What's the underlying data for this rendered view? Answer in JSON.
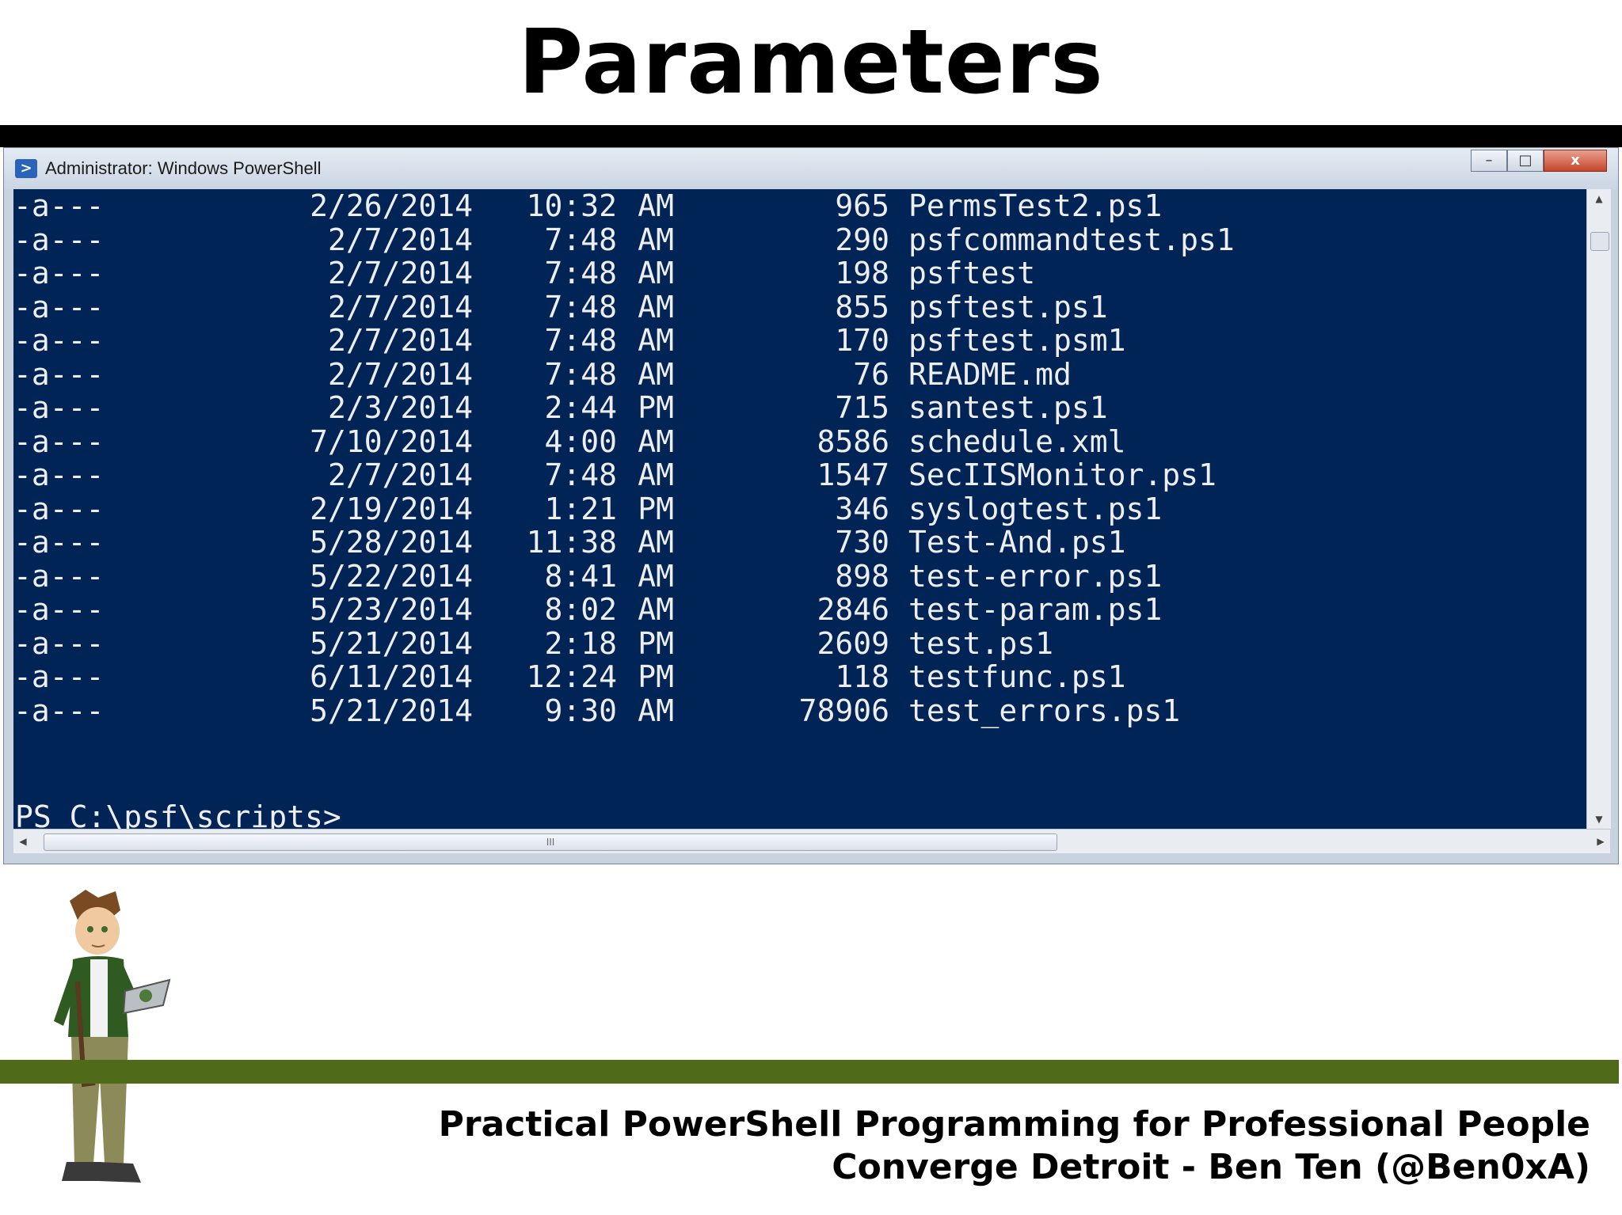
{
  "slide": {
    "title": "Parameters",
    "footer_line1": "Practical PowerShell Programming for Professional People",
    "footer_line2": "Converge Detroit - Ben Ten (@Ben0xA)"
  },
  "window": {
    "title": "Administrator: Windows PowerShell",
    "minimize_glyph": "–",
    "maximize_glyph": "□",
    "close_glyph": "x",
    "app_icon_glyph": ">"
  },
  "console": {
    "rows": [
      {
        "mode": "-a---",
        "date": "2/26/2014",
        "time": "10:32",
        "ampm": "AM",
        "length": "965",
        "name": "PermsTest2.ps1"
      },
      {
        "mode": "-a---",
        "date": "2/7/2014",
        "time": "7:48",
        "ampm": "AM",
        "length": "290",
        "name": "psfcommandtest.ps1"
      },
      {
        "mode": "-a---",
        "date": "2/7/2014",
        "time": "7:48",
        "ampm": "AM",
        "length": "198",
        "name": "psftest"
      },
      {
        "mode": "-a---",
        "date": "2/7/2014",
        "time": "7:48",
        "ampm": "AM",
        "length": "855",
        "name": "psftest.ps1"
      },
      {
        "mode": "-a---",
        "date": "2/7/2014",
        "time": "7:48",
        "ampm": "AM",
        "length": "170",
        "name": "psftest.psm1"
      },
      {
        "mode": "-a---",
        "date": "2/7/2014",
        "time": "7:48",
        "ampm": "AM",
        "length": "76",
        "name": "README.md"
      },
      {
        "mode": "-a---",
        "date": "2/3/2014",
        "time": "2:44",
        "ampm": "PM",
        "length": "715",
        "name": "santest.ps1"
      },
      {
        "mode": "-a---",
        "date": "7/10/2014",
        "time": "4:00",
        "ampm": "AM",
        "length": "8586",
        "name": "schedule.xml"
      },
      {
        "mode": "-a---",
        "date": "2/7/2014",
        "time": "7:48",
        "ampm": "AM",
        "length": "1547",
        "name": "SecIISMonitor.ps1"
      },
      {
        "mode": "-a---",
        "date": "2/19/2014",
        "time": "1:21",
        "ampm": "PM",
        "length": "346",
        "name": "syslogtest.ps1"
      },
      {
        "mode": "-a---",
        "date": "5/28/2014",
        "time": "11:38",
        "ampm": "AM",
        "length": "730",
        "name": "Test-And.ps1"
      },
      {
        "mode": "-a---",
        "date": "5/22/2014",
        "time": "8:41",
        "ampm": "AM",
        "length": "898",
        "name": "test-error.ps1"
      },
      {
        "mode": "-a---",
        "date": "5/23/2014",
        "time": "8:02",
        "ampm": "AM",
        "length": "2846",
        "name": "test-param.ps1"
      },
      {
        "mode": "-a---",
        "date": "5/21/2014",
        "time": "2:18",
        "ampm": "PM",
        "length": "2609",
        "name": "test.ps1"
      },
      {
        "mode": "-a---",
        "date": "6/11/2014",
        "time": "12:24",
        "ampm": "PM",
        "length": "118",
        "name": "testfunc.ps1"
      },
      {
        "mode": "-a---",
        "date": "5/21/2014",
        "time": "9:30",
        "ampm": "AM",
        "length": "78906",
        "name": "test_errors.ps1"
      }
    ],
    "prompt": "PS C:\\psf\\scripts>"
  },
  "scrollbars": {
    "up_arrow": "▲",
    "down_arrow": "▼",
    "left_arrow": "◀",
    "right_arrow": "▶",
    "grip": "III"
  },
  "colors": {
    "console_bg": "#012456",
    "console_fg": "#eeedf0",
    "footer_bar": "#4f6a18"
  }
}
